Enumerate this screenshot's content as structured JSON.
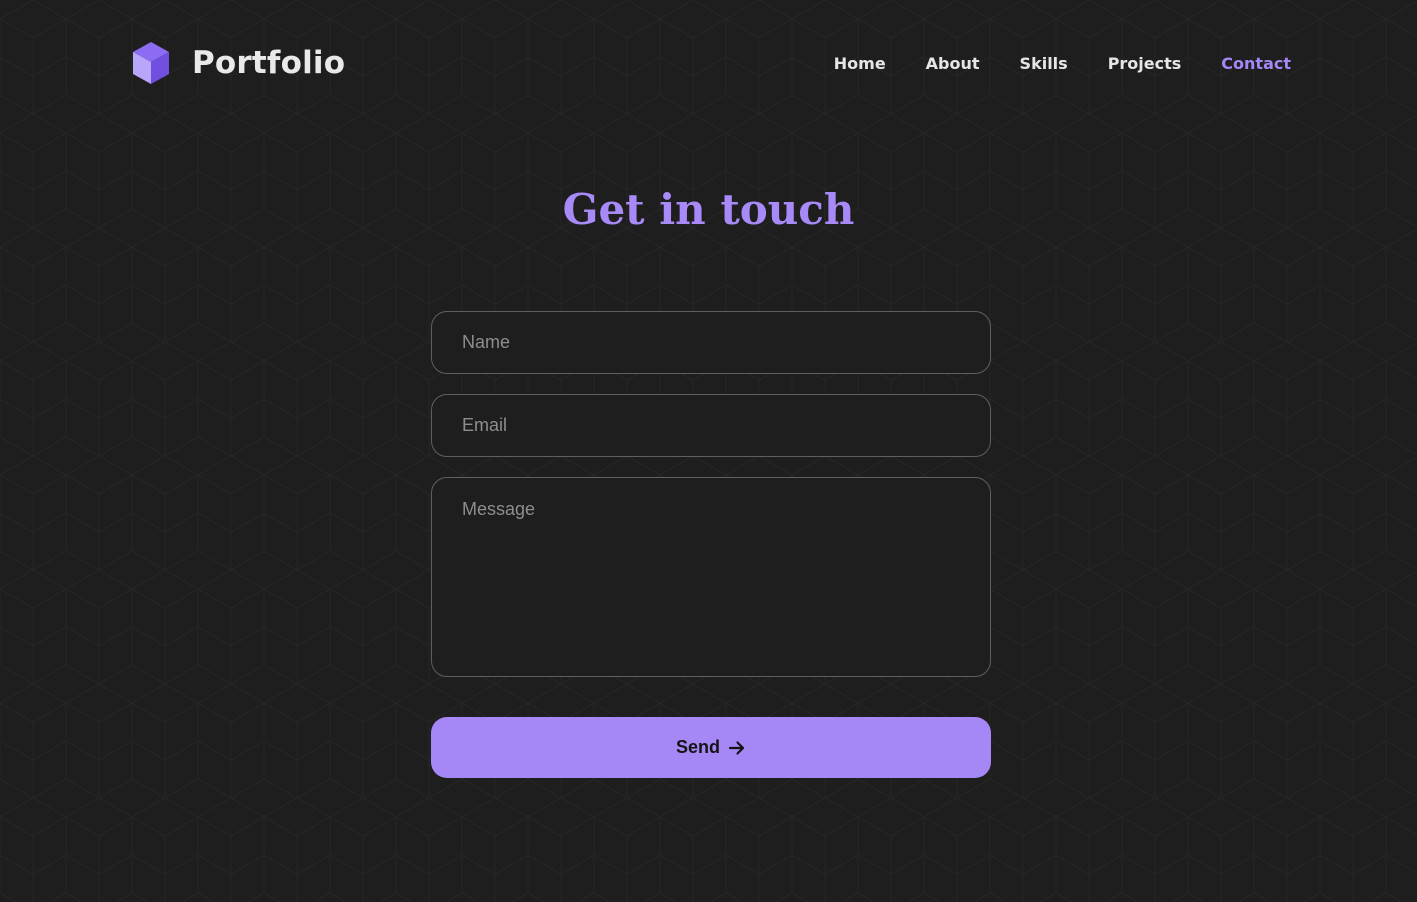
{
  "brand": {
    "name": "Portfolio",
    "icon": "cube-icon",
    "accent_color": "#a587f6"
  },
  "nav": {
    "items": [
      {
        "label": "Home",
        "active": false
      },
      {
        "label": "About",
        "active": false
      },
      {
        "label": "Skills",
        "active": false
      },
      {
        "label": "Projects",
        "active": false
      },
      {
        "label": "Contact",
        "active": true
      }
    ]
  },
  "contact": {
    "title": "Get in touch",
    "name_placeholder": "Name",
    "email_placeholder": "Email",
    "message_placeholder": "Message",
    "send_label": "Send",
    "send_icon": "arrow-right-icon"
  },
  "colors": {
    "background": "#1e1e1e",
    "accent": "#a587f6",
    "text": "#e6e6e6",
    "field_border": "#5f5f5f"
  }
}
